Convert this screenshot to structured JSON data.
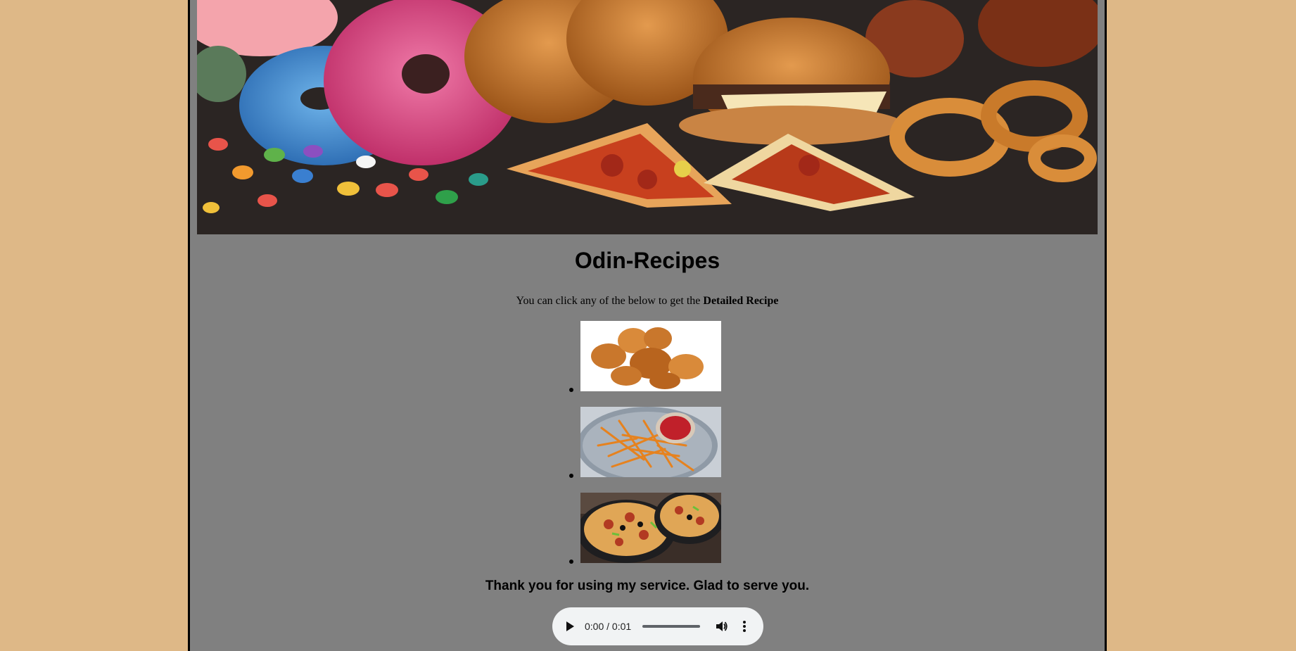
{
  "hero": {
    "icon": "food-banner-image"
  },
  "header": {
    "title": "Odin-Recipes"
  },
  "intro": {
    "text": "You can click any of the below to get the ",
    "bold": "Detailed Recipe"
  },
  "recipes": [
    {
      "icon": "fried-chicken-image"
    },
    {
      "icon": "french-fries-image"
    },
    {
      "icon": "pizza-image"
    }
  ],
  "footer": {
    "thanks": "Thank you for using my service. Glad to serve you."
  },
  "audio_player": {
    "time_display": "0:00 / 0:01",
    "progress": 0,
    "icons": [
      "play-icon",
      "volume-icon",
      "more-options-icon"
    ]
  },
  "colors": {
    "page_background": "#deb887",
    "content_background": "#808080",
    "border": "#000000"
  }
}
